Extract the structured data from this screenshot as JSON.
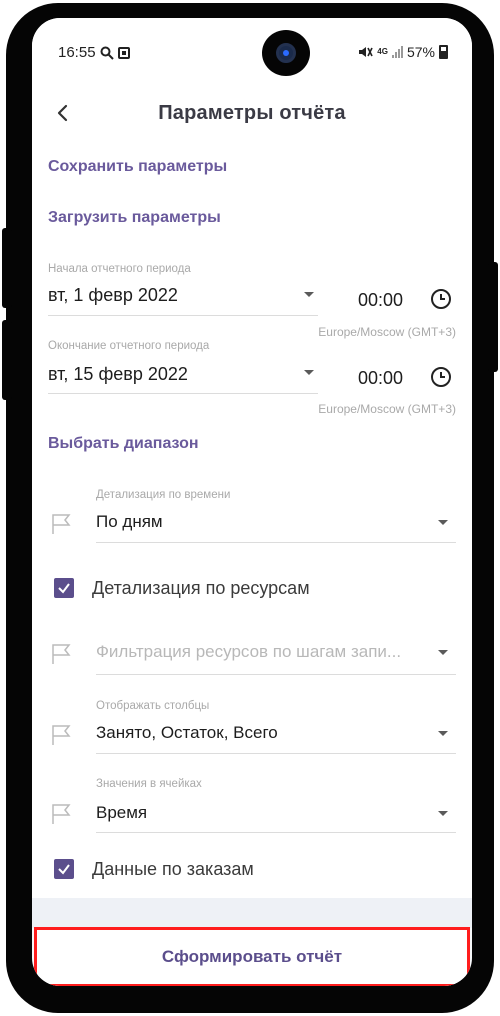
{
  "status_bar": {
    "time": "16:55",
    "network": "4G",
    "battery": "57%"
  },
  "header": {
    "title": "Параметры отчёта"
  },
  "links": {
    "save": "Сохранить параметры",
    "load": "Загрузить параметры",
    "range": "Выбрать диапазон"
  },
  "period_start": {
    "label": "Начала отчетного периода",
    "date": "вт, 1 февр 2022",
    "time": "00:00",
    "timezone": "Europe/Moscow (GMT+3)"
  },
  "period_end": {
    "label": "Окончание отчетного периода",
    "date": "вт, 15 февр 2022",
    "time": "00:00",
    "timezone": "Europe/Moscow (GMT+3)"
  },
  "time_detail": {
    "label": "Детализация по времени",
    "value": "По дням"
  },
  "resource_detail": {
    "label": "Детализация по ресурсам",
    "checked": true
  },
  "resource_filter": {
    "value": "Фильтрация ресурсов по шагам запи..."
  },
  "columns": {
    "label": "Отображать столбцы",
    "value": "Занято, Остаток, Всего"
  },
  "cell_values": {
    "label": "Значения в ячейках",
    "value": "Время"
  },
  "order_data": {
    "label": "Данные по заказам",
    "checked": true
  },
  "submit": {
    "label": "Сформировать отчёт"
  },
  "colors": {
    "accent": "#5b4e8c",
    "link": "#6a5a9c",
    "highlight_border": "#ff1d1d"
  }
}
